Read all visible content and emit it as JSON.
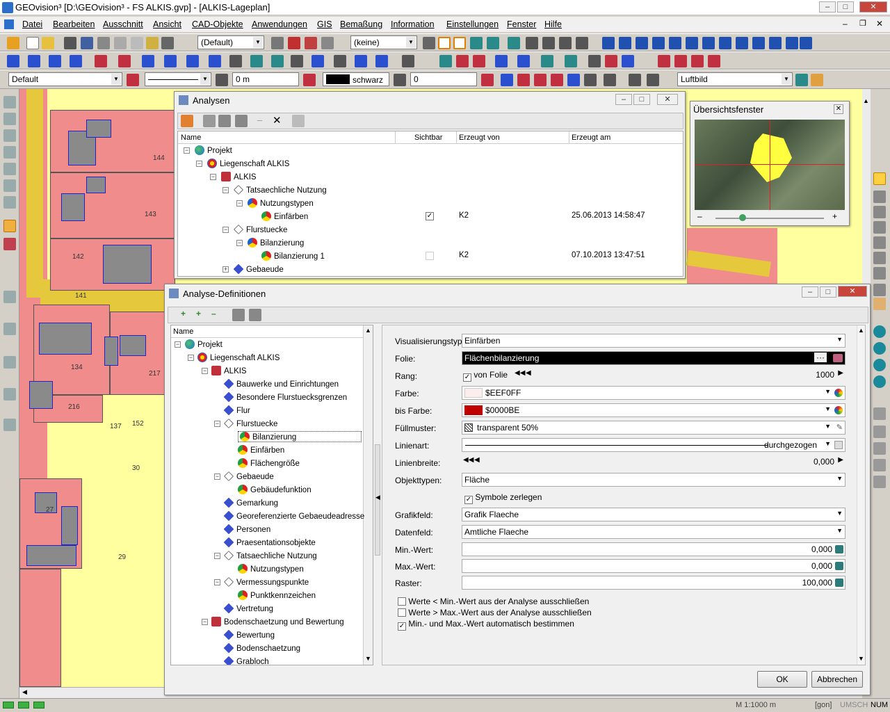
{
  "window": {
    "title": "GEOvision³  [D:\\GEOvision³ - FS ALKIS.gvp] - [ALKIS-Lageplan]"
  },
  "menu": [
    "Datei",
    "Bearbeiten",
    "Ausschnitt",
    "Ansicht",
    "CAD-Objekte",
    "Anwendungen",
    "GIS",
    "Bemaßung",
    "Information",
    "Einstellungen",
    "Fenster",
    "Hilfe"
  ],
  "toolbar": {
    "style_default": "(Default)",
    "layer_none": "(keine)",
    "default_label": "Default",
    "distance": "0 m",
    "color_name": "schwarz",
    "number": "0",
    "basemap": "Luftbild"
  },
  "map": {
    "parcels": [
      "144",
      "143",
      "142",
      "141",
      "134",
      "217",
      "216",
      "137",
      "152",
      "30",
      "27",
      "29"
    ]
  },
  "overview": {
    "title": "Übersichtsfenster"
  },
  "analysen": {
    "title": "Analysen",
    "columns": [
      "Name",
      "Sichtbar",
      "Erzeugt von",
      "Erzeugt am"
    ],
    "rows": [
      {
        "label": "Projekt"
      },
      {
        "label": "Liegenschaft ALKIS"
      },
      {
        "label": "ALKIS"
      },
      {
        "label": "Tatsaechliche Nutzung"
      },
      {
        "label": "Nutzungstypen"
      },
      {
        "label": "Einfärben",
        "visible": "✓",
        "by": "K2",
        "date": "25.06.2013 14:58:47"
      },
      {
        "label": "Flurstuecke"
      },
      {
        "label": "Bilanzierung"
      },
      {
        "label": "Bilanzierung 1",
        "visible": "",
        "by": "K2",
        "date": "07.10.2013 13:47:51"
      },
      {
        "label": "Gebaeude"
      }
    ]
  },
  "defs": {
    "title": "Analyse-Definitionen",
    "tree_header": "Name",
    "tree": [
      "Projekt",
      "Liegenschaft ALKIS",
      "ALKIS",
      "Bauwerke und Einrichtungen",
      "Besondere Flurstuecksgrenzen",
      "Flur",
      "Flurstuecke",
      "Bilanzierung",
      "Einfärben",
      "Flächengröße",
      "Gebaeude",
      "Gebäudefunktion",
      "Gemarkung",
      "Georeferenzierte Gebaeudeadresse",
      "Personen",
      "Praesentationsobjekte",
      "Tatsaechliche Nutzung",
      "Nutzungstypen",
      "Vermessungspunkte",
      "Punktkennzeichen",
      "Vertretung",
      "Bodenschaetzung und Bewertung",
      "Bewertung",
      "Bodenschaetzung",
      "Grabloch"
    ],
    "labels": {
      "vis": "Visualisierungstyp:",
      "folie": "Folie:",
      "rang": "Rang:",
      "farbe": "Farbe:",
      "bisfarbe": "bis Farbe:",
      "fuell": "Füllmuster:",
      "linienart": "Linienart:",
      "linienbreite": "Linienbreite:",
      "objekttypen": "Objekttypen:",
      "grafikfeld": "Grafikfeld:",
      "datenfeld": "Datenfeld:",
      "min": "Min.-Wert:",
      "max": "Max.-Wert:",
      "raster": "Raster:"
    },
    "values": {
      "vis": "Einfärben",
      "folie": "Flächenbilanzierung",
      "von_folie": "von Folie",
      "rang": "1000",
      "farbe": "$EEF0FF",
      "bisfarbe": "$0000BE",
      "fuell": "transparent 50%",
      "linienart": "durchgezogen",
      "linienbreite": "0,000",
      "objekttypen": "Fläche",
      "symbole": "Symbole zerlegen",
      "grafikfeld": "Grafik Flaeche",
      "datenfeld": "Amtliche Flaeche",
      "min": "0,000",
      "max": "0,000",
      "raster": "100,000"
    },
    "checks": [
      {
        "label": "Werte < Min.-Wert aus der Analyse ausschließen",
        "checked": ""
      },
      {
        "label": "Werte > Max.-Wert aus der Analyse ausschließen",
        "checked": ""
      },
      {
        "label": "Min.- und Max.-Wert automatisch bestimmen",
        "checked": "✓"
      }
    ],
    "ok": "OK",
    "cancel": "Abbrechen"
  },
  "status": {
    "scale": "M 1:1000  m",
    "gon": "[gon]",
    "umsch": "UMSCH",
    "num": "NUM"
  },
  "colors": {
    "farbe": "#EEF0FF",
    "bisfarbe": "#BE0000",
    "parcel": "#f08c8c",
    "landuse": "#ffffa0"
  }
}
